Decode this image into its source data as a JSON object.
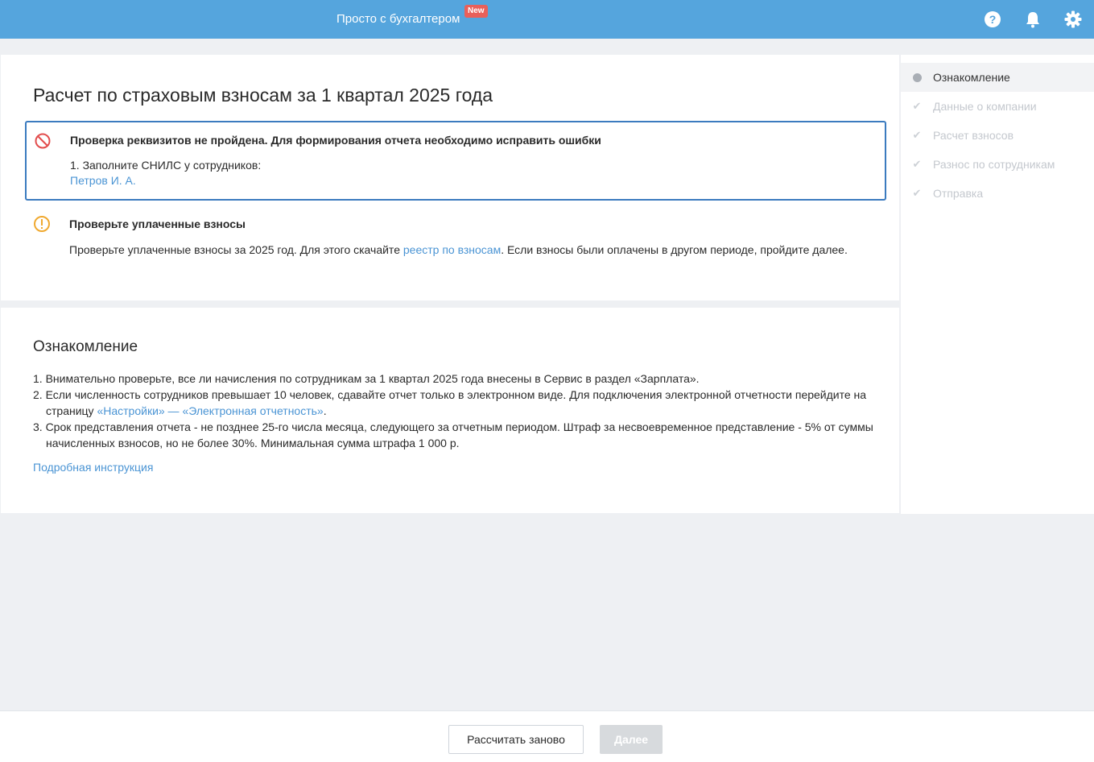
{
  "header": {
    "link_label": "Просто с бухгалтером",
    "badge": "New",
    "icons": [
      "help-icon",
      "bell-icon",
      "gear-icon"
    ]
  },
  "report": {
    "title": "Расчет по страховым взносам за 1 квартал 2025 года",
    "error": {
      "title": "Проверка реквизитов не пройдена. Для формирования отчета необходимо исправить ошибки",
      "item": "1. Заполните СНИЛС у сотрудников:",
      "employee_link": "Петров И. А."
    },
    "warning": {
      "title": "Проверьте уплаченные взносы",
      "text_before": "Проверьте уплаченные взносы за 2025 год. Для этого скачайте ",
      "link": "реестр по взносам",
      "text_after": ". Если взносы были оплачены в другом периоде, пройдите далее."
    }
  },
  "intro": {
    "title": "Ознакомление",
    "item1": "1. Внимательно проверьте, все ли начисления по сотрудникам за 1 квартал 2025 года внесены в Сервис в раздел «Зарплата».",
    "item2_before": "2. Если численность сотрудников превышает 10 человек, сдавайте отчет только в электронном виде. Для подключения электронной отчетности перейдите на страницу ",
    "item2_link": "«Настройки» — «Электронная отчетность»",
    "item2_after": ".",
    "item3": "3. Срок представления отчета - не позднее 25-го числа месяца, следующего за отчетным периодом. Штраф за несвоевременное представление - 5% от суммы начисленных взносов, но не более 30%. Минимальная сумма штрафа 1 000 р.",
    "detail_link": "Подробная инструкция"
  },
  "steps": [
    {
      "label": "Ознакомление",
      "state": "active"
    },
    {
      "label": "Данные о компании",
      "state": "disabled"
    },
    {
      "label": "Расчет взносов",
      "state": "disabled"
    },
    {
      "label": "Разнос по сотрудникам",
      "state": "disabled"
    },
    {
      "label": "Отправка",
      "state": "disabled"
    }
  ],
  "footer": {
    "recalc_label": "Рассчитать заново",
    "next_label": "Далее"
  },
  "colors": {
    "header_bg": "#55a5dd",
    "error_border": "#3b7bbf",
    "error_icon": "#e24d4d",
    "warning_icon": "#f0a930",
    "link": "#4a94d4"
  }
}
